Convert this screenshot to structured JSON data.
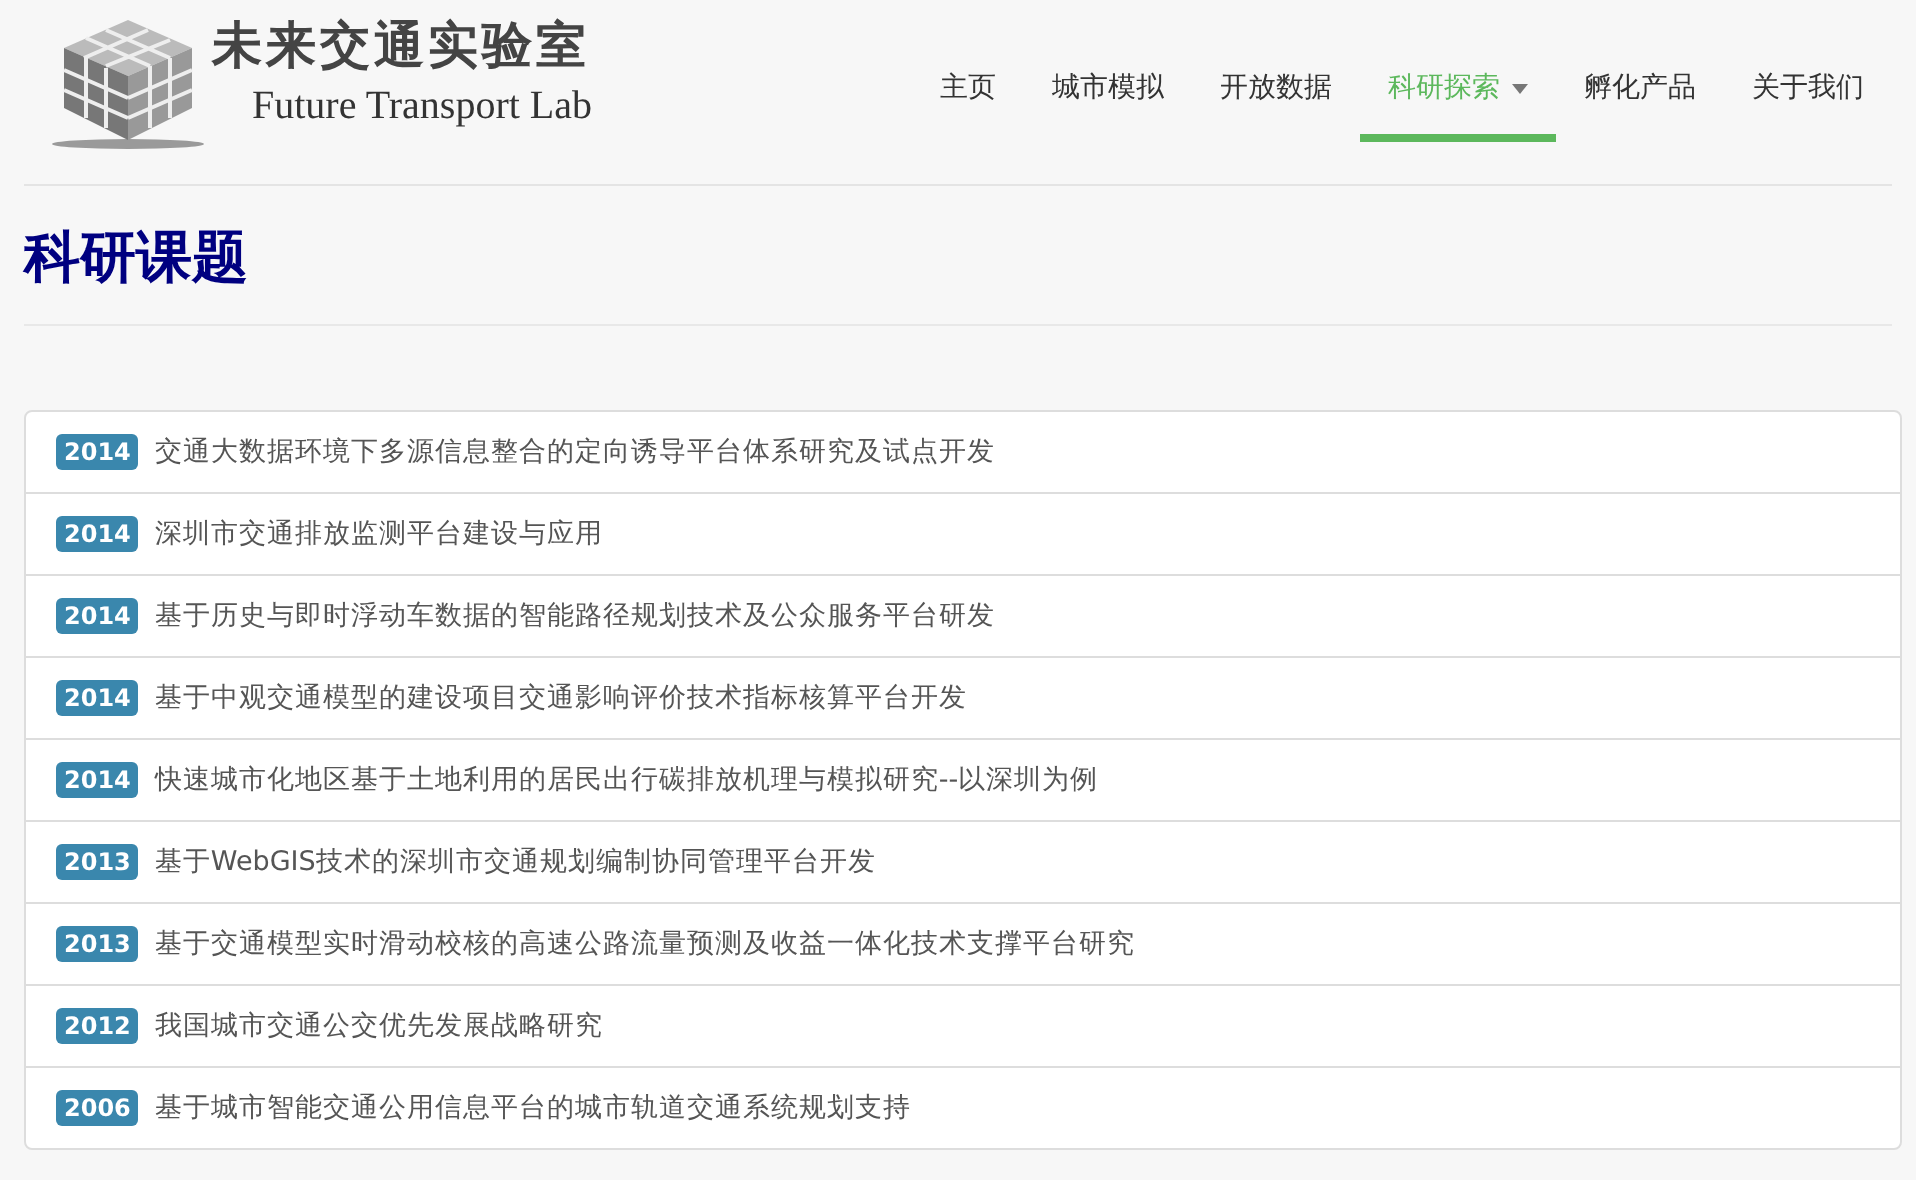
{
  "logo": {
    "title": "未来交通实验室",
    "subtitle": "Future Transport Lab"
  },
  "nav": [
    {
      "label": "主页",
      "selected": false,
      "dropdown": false
    },
    {
      "label": "城市模拟",
      "selected": false,
      "dropdown": false
    },
    {
      "label": "开放数据",
      "selected": false,
      "dropdown": false
    },
    {
      "label": "科研探索",
      "selected": true,
      "dropdown": true
    },
    {
      "label": "孵化产品",
      "selected": false,
      "dropdown": false
    },
    {
      "label": "关于我们",
      "selected": false,
      "dropdown": false
    }
  ],
  "page_title": "科研课题",
  "projects": [
    {
      "year": "2014",
      "title": "交通大数据环境下多源信息整合的定向诱导平台体系研究及试点开发"
    },
    {
      "year": "2014",
      "title": "深圳市交通排放监测平台建设与应用"
    },
    {
      "year": "2014",
      "title": "基于历史与即时浮动车数据的智能路径规划技术及公众服务平台研发"
    },
    {
      "year": "2014",
      "title": "基于中观交通模型的建设项目交通影响评价技术指标核算平台开发"
    },
    {
      "year": "2014",
      "title": "快速城市化地区基于土地利用的居民出行碳排放机理与模拟研究--以深圳为例"
    },
    {
      "year": "2013",
      "title": "基于WebGIS技术的深圳市交通规划编制协同管理平台开发"
    },
    {
      "year": "2013",
      "title": "基于交通模型实时滑动校核的高速公路流量预测及收益一体化技术支撑平台研究"
    },
    {
      "year": "2012",
      "title": "我国城市交通公交优先发展战略研究"
    },
    {
      "year": "2006",
      "title": "基于城市智能交通公用信息平台的城市轨道交通系统规划支持"
    }
  ]
}
